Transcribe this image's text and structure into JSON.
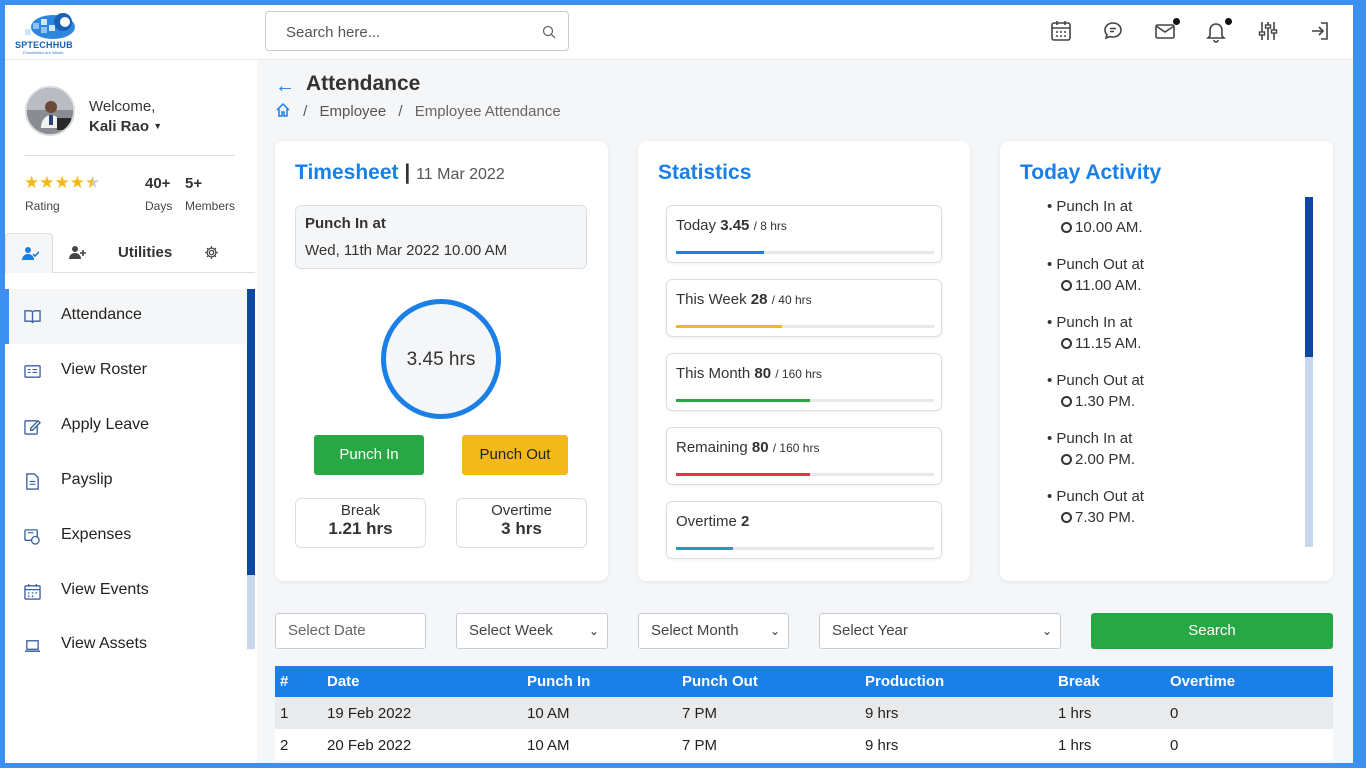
{
  "brand": {
    "name": "SPTECHHUB",
    "tagline": "Possibilities are infinite"
  },
  "header": {
    "search_placeholder": "Search here..."
  },
  "user": {
    "welcome": "Welcome,",
    "name": "Kali Rao",
    "rating_label": "Rating",
    "rating_value": 4.5,
    "days_value": "40+",
    "days_label": "Days",
    "members_value": "5+",
    "members_label": "Members"
  },
  "sidebar": {
    "utilities_tab": "Utilities",
    "items": [
      {
        "label": "Attendance",
        "icon": "book-icon"
      },
      {
        "label": "View Roster",
        "icon": "id-card-icon"
      },
      {
        "label": "Apply Leave",
        "icon": "edit-icon"
      },
      {
        "label": "Payslip",
        "icon": "document-icon"
      },
      {
        "label": "Expenses",
        "icon": "expenses-icon"
      },
      {
        "label": "View Events",
        "icon": "calendar-icon"
      },
      {
        "label": "View Assets",
        "icon": "laptop-icon"
      }
    ]
  },
  "page": {
    "title": "Attendance",
    "breadcrumb": [
      "Employee",
      "Employee Attendance"
    ]
  },
  "timesheet": {
    "title": "Timesheet",
    "sep": "|",
    "date": "11 Mar 2022",
    "punch_label": "Punch In at",
    "punch_value": "Wed, 11th Mar 2022 10.00 AM",
    "hours": "3.45 hrs",
    "punch_in_btn": "Punch In",
    "punch_out_btn": "Punch Out",
    "break_label": "Break",
    "break_value": "1.21 hrs",
    "overtime_label": "Overtime",
    "overtime_value": "3 hrs"
  },
  "statistics": {
    "title": "Statistics",
    "items": [
      {
        "label": "Today",
        "value": "3.45",
        "of": "/ 8 hrs",
        "progress": 0.34,
        "color": "#1a7fe6"
      },
      {
        "label": "This Week",
        "value": "28",
        "of": "/ 40 hrs",
        "progress": 0.41,
        "color": "#f3b91b"
      },
      {
        "label": "This Month",
        "value": "80",
        "of": "/ 160 hrs",
        "progress": 0.52,
        "color": "#28a745"
      },
      {
        "label": "Remaining",
        "value": "80",
        "of": "/ 160 hrs",
        "progress": 0.52,
        "color": "#dc3545"
      },
      {
        "label": "Overtime",
        "value": "2",
        "of": "",
        "progress": 0.22,
        "color": "#17a2b8"
      }
    ]
  },
  "activity": {
    "title": "Today Activity",
    "items": [
      {
        "label": "Punch In at",
        "time": "10.00 AM."
      },
      {
        "label": "Punch Out at",
        "time": "11.00 AM."
      },
      {
        "label": "Punch In at",
        "time": "11.15 AM."
      },
      {
        "label": "Punch Out at",
        "time": "1.30 PM."
      },
      {
        "label": "Punch In at",
        "time": "2.00 PM."
      },
      {
        "label": "Punch Out at",
        "time": "7.30 PM."
      }
    ]
  },
  "filters": {
    "date_placeholder": "Select Date",
    "week": "Select Week",
    "month": "Select Month",
    "year": "Select Year",
    "search": "Search"
  },
  "table": {
    "headers": [
      "#",
      "Date",
      "Punch In",
      "Punch Out",
      "Production",
      "Break",
      "Overtime"
    ],
    "rows": [
      [
        "1",
        "19 Feb 2022",
        "10 AM",
        "7 PM",
        "9 hrs",
        "1 hrs",
        "0"
      ],
      [
        "2",
        "20 Feb 2022",
        "10 AM",
        "7 PM",
        "9 hrs",
        "1 hrs",
        "0"
      ]
    ]
  },
  "colors": {
    "accent": "#1a7fe6",
    "success": "#28a745",
    "warning": "#f3b91b",
    "frame": "#3d8ff0"
  }
}
